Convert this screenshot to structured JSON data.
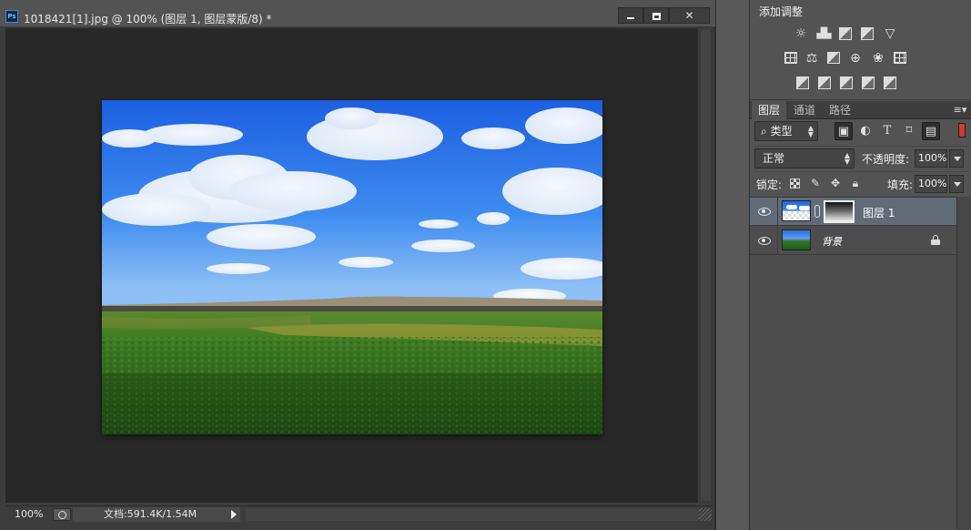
{
  "document": {
    "title": "1018421[1].jpg @ 100% (图层 1, 图层蒙版/8) *",
    "app_badge": "Ps",
    "status": {
      "zoom": "100%",
      "doc_size": "文档:591.4K/1.54M"
    }
  },
  "adjustments": {
    "title": "添加调整",
    "icons": [
      "brightness-contrast-icon",
      "levels-icon",
      "curves-icon",
      "exposure-icon",
      "vibrance-icon",
      "hue-saturation-icon",
      "color-balance-icon",
      "black-white-icon",
      "photo-filter-icon",
      "channel-mixer-icon",
      "color-lookup-icon",
      "invert-icon",
      "posterize-icon",
      "threshold-icon",
      "selective-color-icon",
      "gradient-map-icon"
    ]
  },
  "layers_panel": {
    "tabs": [
      {
        "label": "图层",
        "active": true
      },
      {
        "label": "通道",
        "active": false
      },
      {
        "label": "路径",
        "active": false
      }
    ],
    "filter": {
      "kind_label": "类型"
    },
    "blend_mode": "正常",
    "opacity_label": "不透明度:",
    "opacity_value": "100%",
    "lock_label": "锁定:",
    "fill_label": "填充:",
    "fill_value": "100%",
    "layers": [
      {
        "name": "图层 1",
        "selected": true,
        "has_mask": true,
        "visible": true
      },
      {
        "name": "背景",
        "selected": false,
        "locked": true,
        "visible": true
      }
    ]
  },
  "colors": {
    "accent_selected_row": "#616b78",
    "filter_toggle": "#d43a2a",
    "canvas_bg": "#282828",
    "panel_bg": "#535353"
  }
}
